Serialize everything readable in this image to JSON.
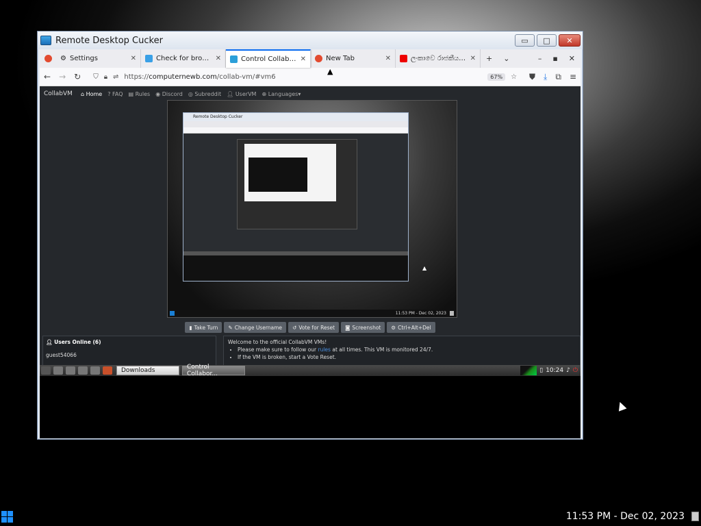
{
  "window": {
    "title": "Remote Desktop Cucker",
    "minimize": "▭",
    "maximize": "□",
    "close": "✕"
  },
  "tabs": [
    {
      "label": "Settings",
      "close": "✕",
      "active": false
    },
    {
      "label": "Check for browser up",
      "close": "✕",
      "active": false
    },
    {
      "label": "Control Collaborative",
      "close": "✕",
      "active": true
    },
    {
      "label": "New Tab",
      "close": "✕",
      "active": false
    },
    {
      "label": "ලංකාවෙ රාජකීය ජාතිය",
      "close": "✕",
      "active": false
    }
  ],
  "tab_controls": {
    "new_tab": "+",
    "list": "⌄",
    "min": "–",
    "max": "▪",
    "close": "✕"
  },
  "nav": {
    "back": "←",
    "forward": "→",
    "reload": "↻",
    "url_prefix": "https://",
    "url_domain": "computernewb.com",
    "url_path": "/collab-vm/#vm6",
    "zoom": "67%"
  },
  "cvnav": {
    "brand": "CollabVM",
    "home": "Home",
    "faq": "FAQ",
    "rules": "Rules",
    "discord": "Discord",
    "subreddit": "Subreddit",
    "uservm": "UserVM",
    "languages": "Languages"
  },
  "inner": {
    "title": "Remote Desktop Cucker",
    "clock": "11:53 PM - Dec 02, 2023"
  },
  "buttons": {
    "take_turn": "Take Turn",
    "change_username": "Change Username",
    "vote_reset": "Vote for Reset",
    "screenshot": "Screenshot",
    "ctrl_alt_del": "Ctrl+Alt+Del"
  },
  "users": {
    "header": "Users Online (6)",
    "list": [
      "guest54066"
    ]
  },
  "chat": {
    "welcome": "Welcome to the official CollabVM VMs!",
    "line1_pre": "Please make sure to follow our ",
    "line1_link": "rules",
    "line1_post": " at all times. This VM is monitored 24/7.",
    "line2": "If the VM is broken, start a Vote Reset."
  },
  "lintaskbar": {
    "app1": "Downloads",
    "app2": "Control Collabor...",
    "clock": "10:24"
  },
  "taskbar": {
    "clock": "11:53 PM - Dec 02, 2023"
  }
}
